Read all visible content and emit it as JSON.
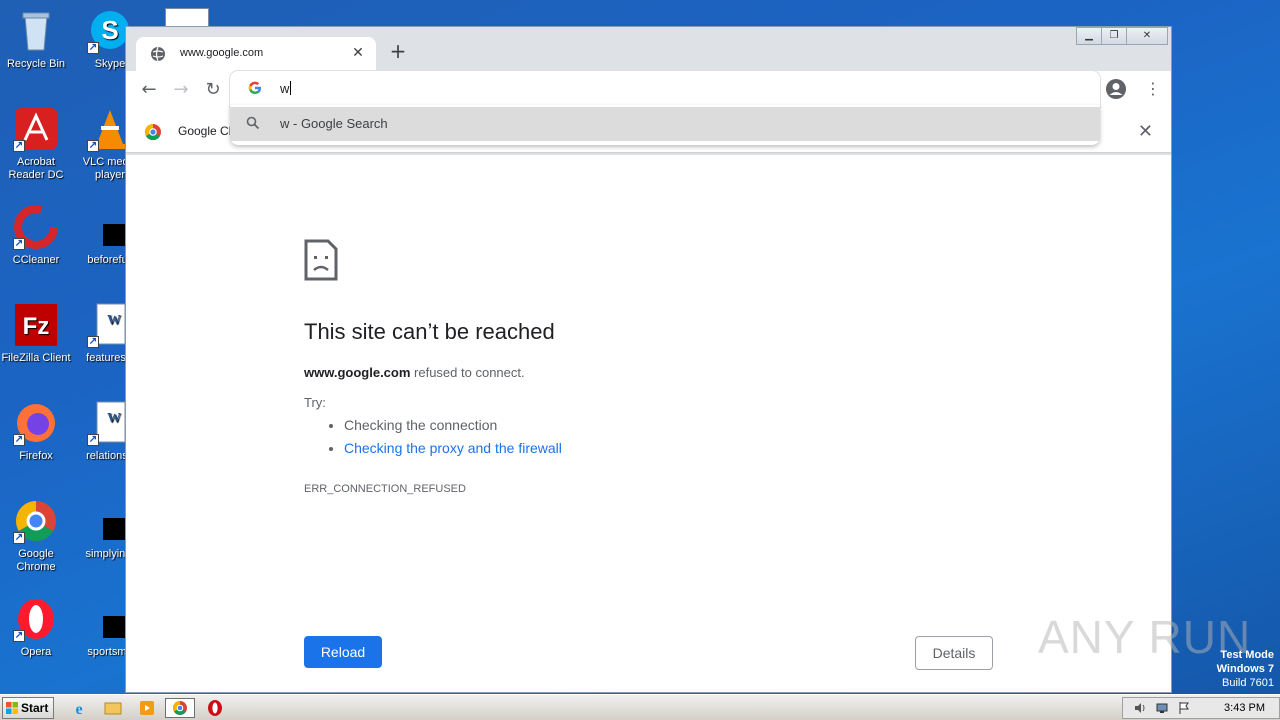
{
  "desktop": {
    "icons": [
      {
        "label": "Recycle Bin"
      },
      {
        "label": "Skype"
      },
      {
        "label": "Acrobat Reader DC"
      },
      {
        "label": "VLC media player"
      },
      {
        "label": "CCleaner"
      },
      {
        "label": "beforefull"
      },
      {
        "label": "FileZilla Client"
      },
      {
        "label": "featuresis"
      },
      {
        "label": "Firefox"
      },
      {
        "label": "relationsh"
      },
      {
        "label": "Google Chrome"
      },
      {
        "label": "simplyinte"
      },
      {
        "label": "Opera"
      },
      {
        "label": "sportsme"
      }
    ]
  },
  "browser": {
    "tab_title": "www.google.com",
    "omnibox_text": "w",
    "suggestion": "w - Google Search",
    "infobar_text": "Google Cl",
    "colors": {
      "accent": "#1a73e8",
      "tabstrip": "#dee1e6"
    }
  },
  "error_page": {
    "title": "This site can’t be reached",
    "host": "www.google.com",
    "message": " refused to connect.",
    "try_label": "Try:",
    "suggestions": [
      "Checking the connection",
      "Checking the proxy and the firewall"
    ],
    "error_code": "ERR_CONNECTION_REFUSED",
    "reload_label": "Reload",
    "details_label": "Details"
  },
  "watermark": "ANY RUN",
  "os": {
    "test_mode": "Test Mode",
    "version": "Windows 7",
    "build": "Build 7601",
    "start_label": "Start",
    "clock": "3:43 PM"
  }
}
